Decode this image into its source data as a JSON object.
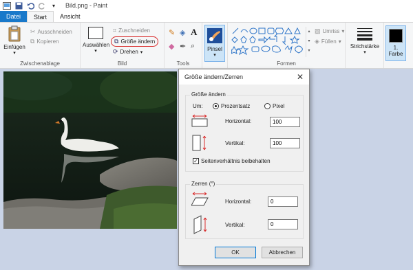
{
  "window": {
    "title": "Bild.png - Paint"
  },
  "tabs": [
    {
      "label": "Datei"
    },
    {
      "label": "Start"
    },
    {
      "label": "Ansicht"
    }
  ],
  "ribbon": {
    "clipboard": {
      "paste": "Einfügen",
      "cut": "Ausschneiden",
      "copy": "Kopieren",
      "label": "Zwischenablage"
    },
    "image": {
      "select": "Auswählen",
      "crop": "Zuschneiden",
      "resize": "Größe ändern",
      "rotate": "Drehen",
      "label": "Bild"
    },
    "tools": {
      "label": "Tools"
    },
    "brushes": {
      "label": "Pinsel"
    },
    "shapes": {
      "outline": "Umriss",
      "fill": "Füllen",
      "label": "Formen"
    },
    "size": {
      "label": "Strichstärke"
    },
    "color": {
      "label": "1. Farbe"
    }
  },
  "dialog": {
    "title": "Größe ändern/Zerren",
    "resize_group": "Größe ändern",
    "by_label": "Um:",
    "percent_label": "Prozentsatz",
    "pixel_label": "Pixel",
    "horizontal_label": "Horizontal:",
    "horizontal_value": "100",
    "vertical_label": "Vertikal:",
    "vertical_value": "100",
    "keep_ratio_label": "Seitenverhältnis beibehalten",
    "skew_group": "Zerren (°)",
    "skew_horizontal_label": "Horizontal:",
    "skew_horizontal_value": "0",
    "skew_vertical_label": "Vertikal:",
    "skew_vertical_value": "0",
    "ok_label": "OK",
    "cancel_label": "Abbrechen"
  },
  "colors": {
    "accent": "#1979ca",
    "highlight": "#d92b2b"
  }
}
